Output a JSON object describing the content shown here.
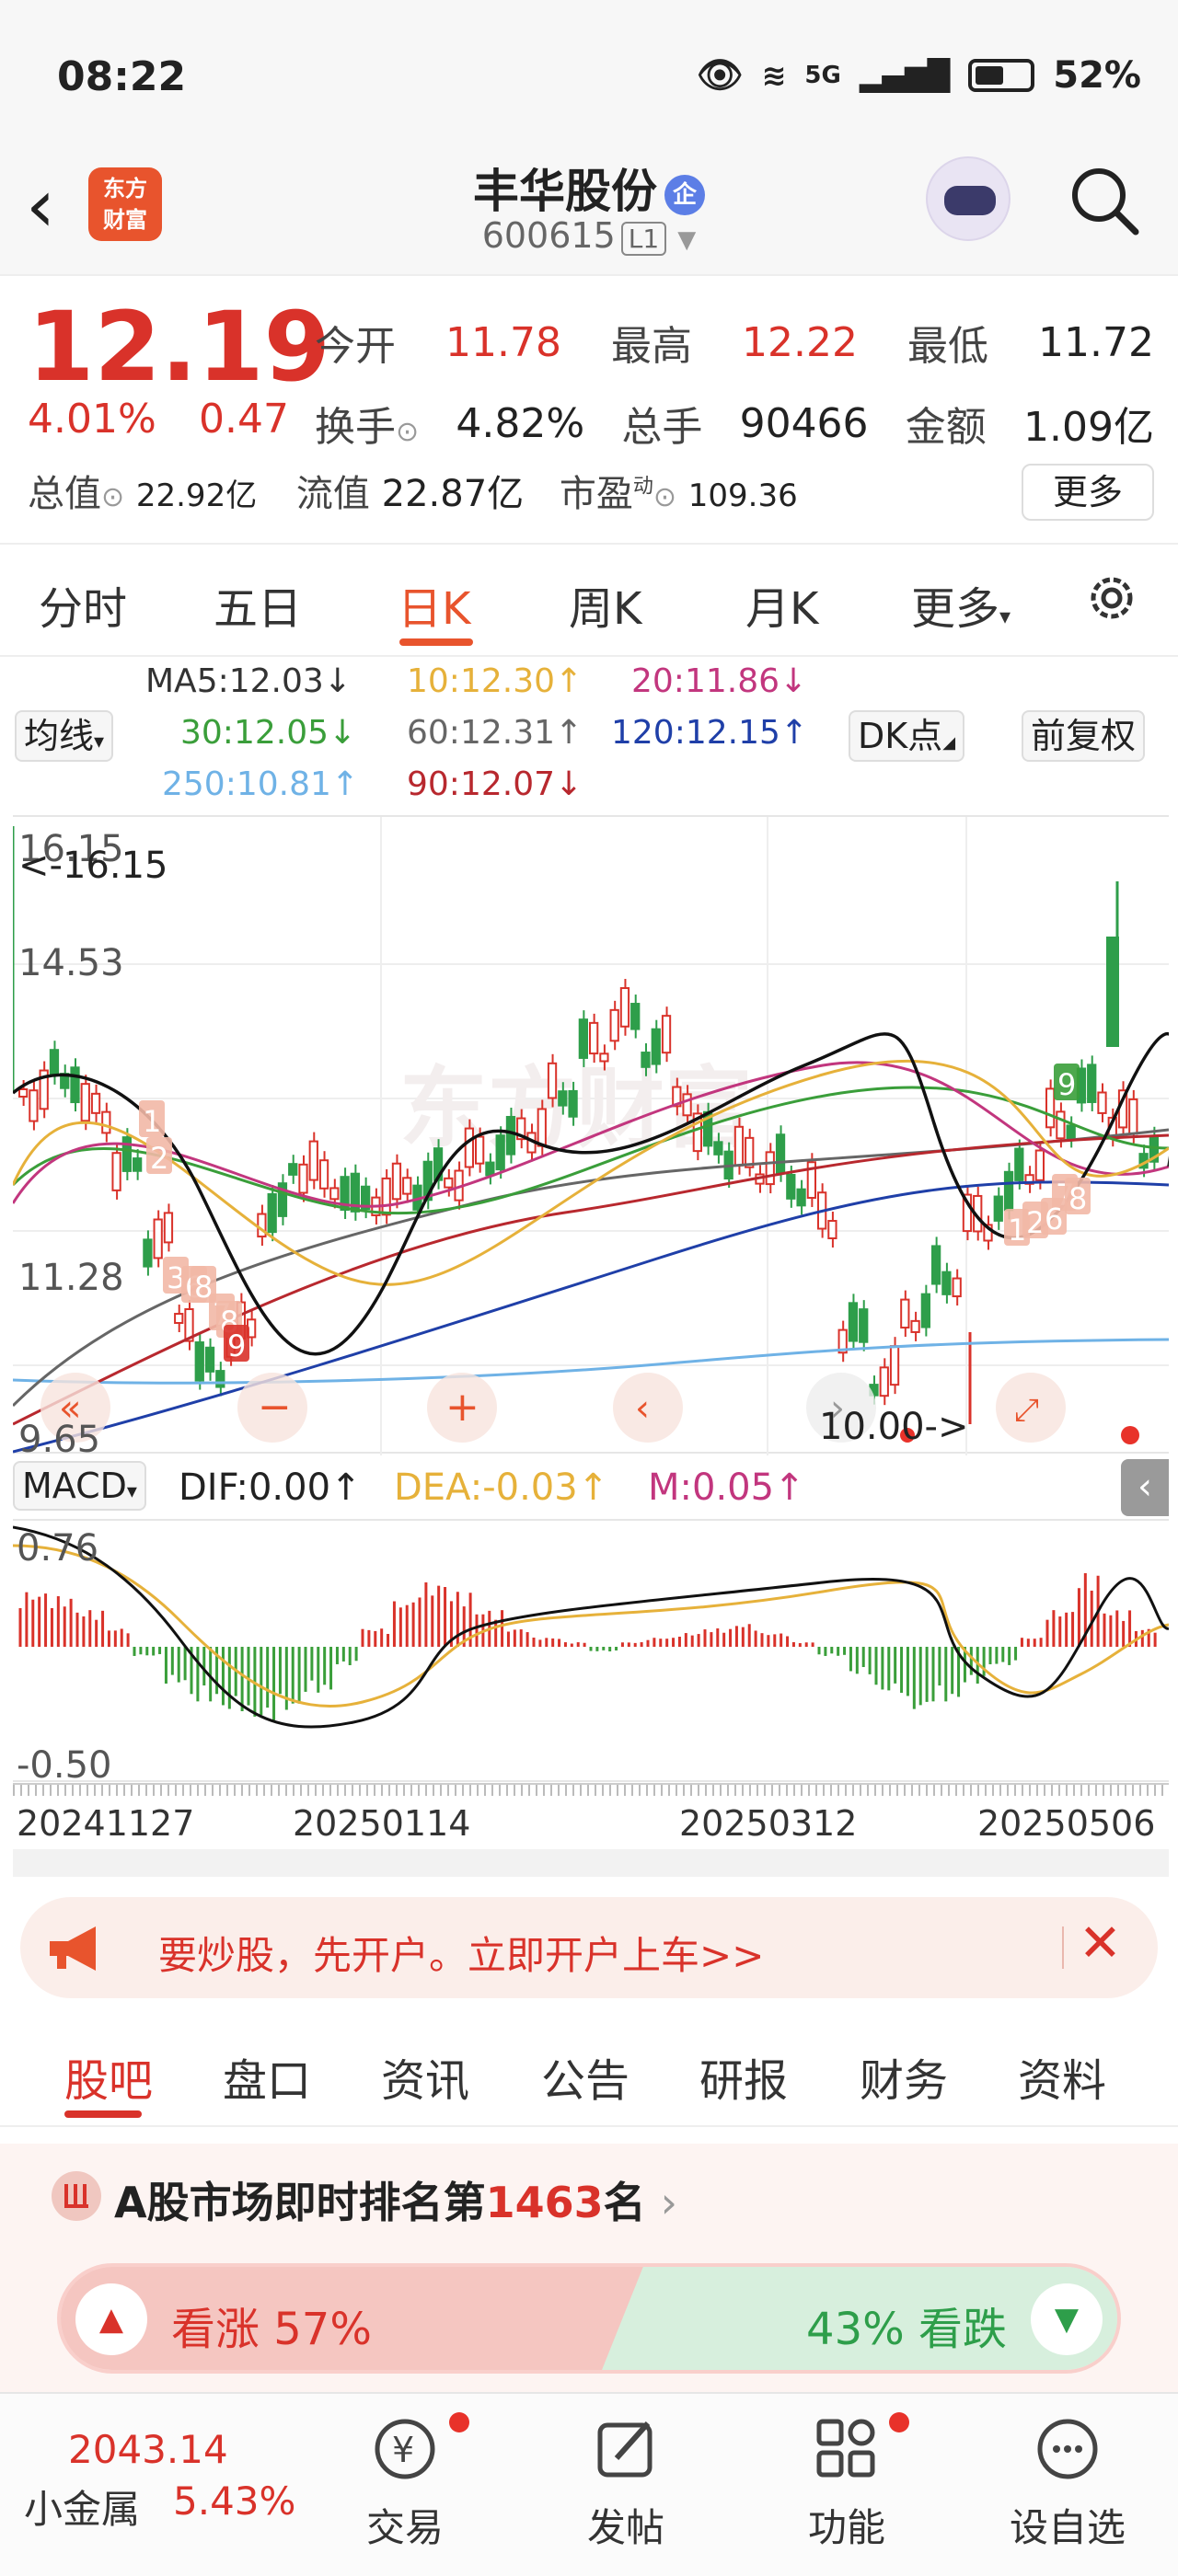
{
  "status_bar": {
    "time": "08:22",
    "network": "5G",
    "battery": "52%"
  },
  "header": {
    "logo_line1": "东方",
    "logo_line2": "财富",
    "name": "丰华股份",
    "badge": "企",
    "code": "600615",
    "level": "L1"
  },
  "quote": {
    "price": "12.19",
    "change_pct": "4.01%",
    "change": "0.47",
    "fields": [
      {
        "label": "今开",
        "value": "11.78",
        "red": true
      },
      {
        "label": "最高",
        "value": "12.22",
        "red": true
      },
      {
        "label": "最低",
        "value": "11.72",
        "red": false
      },
      {
        "label": "换手",
        "value": "4.82%",
        "red": false
      },
      {
        "label": "总手",
        "value": "90466",
        "red": false
      },
      {
        "label": "金额",
        "value": "1.09亿",
        "red": false
      }
    ],
    "total_value_label": "总值",
    "total_value": "22.92亿",
    "float_value_label": "流值",
    "float_value": "22.87亿",
    "pe_label": "市盈",
    "pe_sup": "动",
    "pe": "109.36",
    "more": "更多"
  },
  "tabs": [
    "分时",
    "五日",
    "日K",
    "周K",
    "月K",
    "更多"
  ],
  "ma": {
    "selector": "均线",
    "dk": "DK点",
    "adjust": "前复权",
    "items": [
      {
        "text": "MA5:12.03↓",
        "color": "#333333"
      },
      {
        "text": "10:12.30↑",
        "color": "#e6b13a"
      },
      {
        "text": "20:11.86↓",
        "color": "#c2367e"
      },
      {
        "text": "30:12.05↓",
        "color": "#3a9e3a"
      },
      {
        "text": "60:12.31↑",
        "color": "#666666"
      },
      {
        "text": "120:12.15↑",
        "color": "#1f3fa8"
      },
      {
        "text": "250:10.81↑",
        "color": "#6fb2e6"
      },
      {
        "text": "90:12.07↓",
        "color": "#b8282e"
      }
    ]
  },
  "kchart": {
    "y_top": "16.15",
    "max_note": "<-16.15",
    "y_2": "14.53",
    "y_3": "11.28",
    "y_bottom": "9.65",
    "min_note": "10.00->",
    "watermark": "东方财富"
  },
  "macd": {
    "selector": "MACD",
    "dif": "DIF:0.00↑",
    "dea": "DEA:-0.03↑",
    "m": "M:0.05↑",
    "y_top": "0.76",
    "y_bottom": "-0.50",
    "dates": [
      "20241127",
      "20250114",
      "20250312",
      "20250506"
    ]
  },
  "banner": {
    "text": "要炒股，先开户。立即开户上车>>"
  },
  "subtabs": [
    "股吧",
    "盘口",
    "资讯",
    "公告",
    "研报",
    "财务",
    "资料"
  ],
  "rank": {
    "prefix": "A股市场即时排名第",
    "num": "1463",
    "suffix": "名"
  },
  "vote": {
    "up": "看涨 57%",
    "down": "43% 看跌",
    "up_pct": 57
  },
  "bottom": {
    "index_value": "2043.14",
    "index_name": "小金属",
    "index_pct": "5.43%",
    "items": [
      {
        "label": "交易"
      },
      {
        "label": "发帖"
      },
      {
        "label": "功能"
      },
      {
        "label": "设自选"
      }
    ]
  }
}
